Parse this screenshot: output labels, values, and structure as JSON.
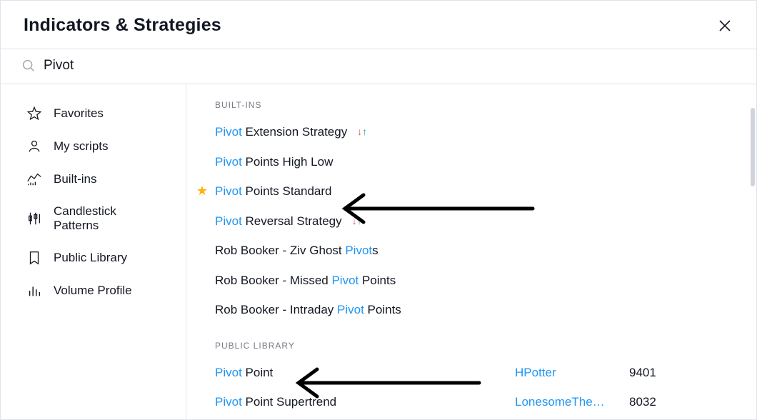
{
  "header": {
    "title": "Indicators & Strategies"
  },
  "search": {
    "value": "Pivot",
    "placeholder": "Search"
  },
  "sidebar": {
    "items": [
      {
        "label": "Favorites",
        "icon": "star-icon"
      },
      {
        "label": "My scripts",
        "icon": "user-icon"
      },
      {
        "label": "Built-ins",
        "icon": "builtins-icon"
      },
      {
        "label": "Candlestick Patterns",
        "icon": "candles-icon"
      },
      {
        "label": "Public Library",
        "icon": "bookmark-icon"
      },
      {
        "label": "Volume Profile",
        "icon": "volume-icon"
      }
    ]
  },
  "sections": {
    "builtins": {
      "heading": "BUILT-INS",
      "items": [
        {
          "match": "Pivot",
          "rest": " Extension Strategy",
          "strategy": true,
          "starred": false
        },
        {
          "match": "Pivot",
          "rest": " Points High Low",
          "strategy": false,
          "starred": false
        },
        {
          "match": "Pivot",
          "rest": " Points Standard",
          "strategy": false,
          "starred": true
        },
        {
          "match": "Pivot",
          "rest": " Reversal Strategy",
          "strategy": true,
          "starred": false
        },
        {
          "prefix": "Rob Booker - Ziv Ghost ",
          "match": "Pivot",
          "rest": "s",
          "strategy": false,
          "starred": false
        },
        {
          "prefix": "Rob Booker - Missed ",
          "match": "Pivot",
          "rest": " Points",
          "strategy": false,
          "starred": false
        },
        {
          "prefix": "Rob Booker - Intraday ",
          "match": "Pivot",
          "rest": " Points",
          "strategy": false,
          "starred": false
        }
      ]
    },
    "public": {
      "heading": "PUBLIC LIBRARY",
      "items": [
        {
          "match": "Pivot",
          "rest": " Point",
          "author": "HPotter",
          "count": "9401"
        },
        {
          "match": "Pivot",
          "rest": " Point Supertrend",
          "author": "LonesomeThe…",
          "count": "8032"
        }
      ]
    }
  }
}
